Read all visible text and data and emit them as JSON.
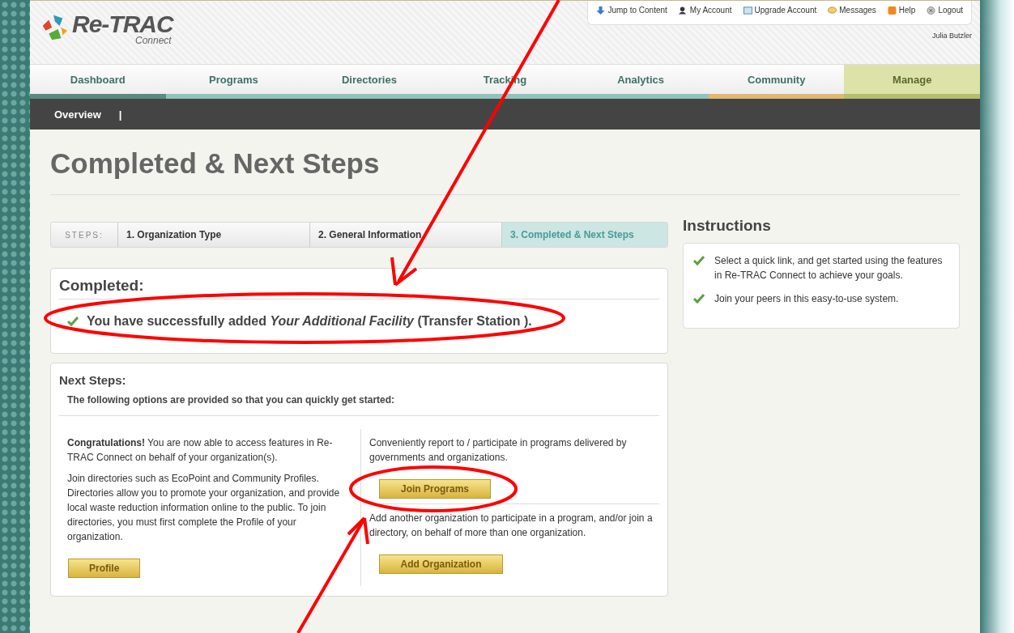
{
  "header": {
    "logo": {
      "name": "Re-TRAC",
      "sub": "Connect"
    },
    "top_links": [
      {
        "label": "Jump to Content",
        "kind": "down"
      },
      {
        "label": "My Account",
        "kind": "user"
      },
      {
        "label": "Upgrade Account",
        "kind": "upgrade"
      },
      {
        "label": "Messages",
        "kind": "messages"
      },
      {
        "label": "Help",
        "kind": "help"
      },
      {
        "label": "Logout",
        "kind": "logout"
      }
    ],
    "user": "Julia Butzler"
  },
  "nav": [
    {
      "label": "Dashboard",
      "selected": false,
      "color": "#5a8a80"
    },
    {
      "label": "Programs",
      "selected": false,
      "color": "#8fc4bc"
    },
    {
      "label": "Directories",
      "selected": false,
      "color": "#8fc4bc"
    },
    {
      "label": "Tracking",
      "selected": false,
      "color": "#8fc4bc"
    },
    {
      "label": "Analytics",
      "selected": false,
      "color": "#8fc4bc"
    },
    {
      "label": "Community",
      "selected": false,
      "color": "#e0b870"
    },
    {
      "label": "Manage",
      "selected": true,
      "color": "#b5bd70"
    }
  ],
  "subnav": {
    "items": [
      "Overview"
    ],
    "separator": "|"
  },
  "page_title": "Completed & Next Steps",
  "steps": {
    "label": "STEPS:",
    "items": [
      {
        "label": "1. Organization Type",
        "selected": false
      },
      {
        "label": "2. General Information",
        "selected": false
      },
      {
        "label": "3. Completed & Next Steps",
        "selected": true
      }
    ]
  },
  "completed": {
    "title": "Completed:",
    "message": "You have successfully added *Your Additional Facility* (Transfer Station )."
  },
  "next_steps": {
    "title": "Next Steps:",
    "intro": "The following options are provided so that you can quickly get started:",
    "left": {
      "paragraphs": [
        "**Congratulations!** You are now able to access features in Re-TRAC Connect on behalf of your organization(s).",
        "Join directories such as EcoPoint and Community Profiles. Directories allow you to promote your organization, and provide local waste reduction information online to the public. To join directories, you must first complete the Profile of your organization."
      ],
      "button": "Profile"
    },
    "right": [
      {
        "text": "Conveniently report to / participate in programs delivered by governments and organizations.",
        "button": "Join Programs"
      },
      {
        "text": "Add another organization to participate in a program, and/or join a directory, on behalf of more than one organization.",
        "button": "Add Organization"
      }
    ]
  },
  "instructions": {
    "title": "Instructions",
    "items": [
      "Select a quick link, and get started using the features in Re-TRAC Connect to achieve your goals.",
      "Join your peers in this easy-to-use system."
    ]
  }
}
